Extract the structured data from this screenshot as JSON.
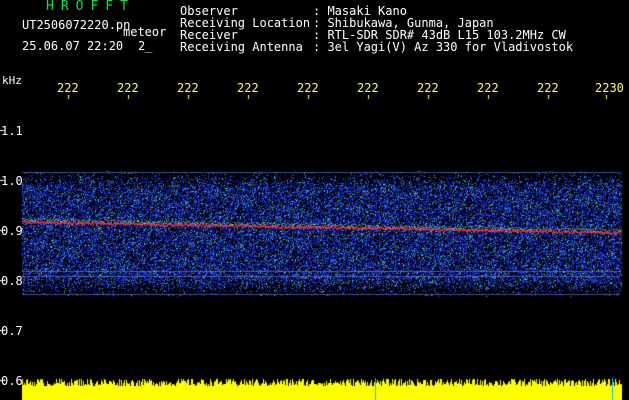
{
  "header": {
    "logo": "HROFFT",
    "filename": "UT2506072220.pn",
    "file_tag": "meteor",
    "datetime": "25.06.07 22:20",
    "index": "2_",
    "info": [
      {
        "label": "Observer",
        "value": ": Masaki Kano"
      },
      {
        "label": "Receiving Location",
        "value": ": Shibukawa, Gunma, Japan"
      },
      {
        "label": "Receiver",
        "value": ": RTL-SDR SDR# 43dB L15 103.2MHz CW"
      },
      {
        "label": "Receiving Antenna",
        "value": ": 3el Yagi(V) Az 330 for Vladivostok"
      }
    ]
  },
  "axes": {
    "y_unit": "kHz",
    "y_ticks": [
      "1.1",
      "1.0",
      "0.9",
      "0.8",
      "0.7",
      "0.6"
    ],
    "time_ticks": [
      "222",
      "222",
      "222",
      "222",
      "222",
      "222",
      "222",
      "222",
      "222",
      "2230"
    ]
  },
  "colors": {
    "background": "#000000",
    "header_green": "#00e84a",
    "text_white": "#ffffff",
    "tick_yellow": "#ffff55",
    "signal_red": "#ff3040",
    "noise_blue": "#1a2aa0",
    "amplitude_yellow": "#ffff00"
  }
}
